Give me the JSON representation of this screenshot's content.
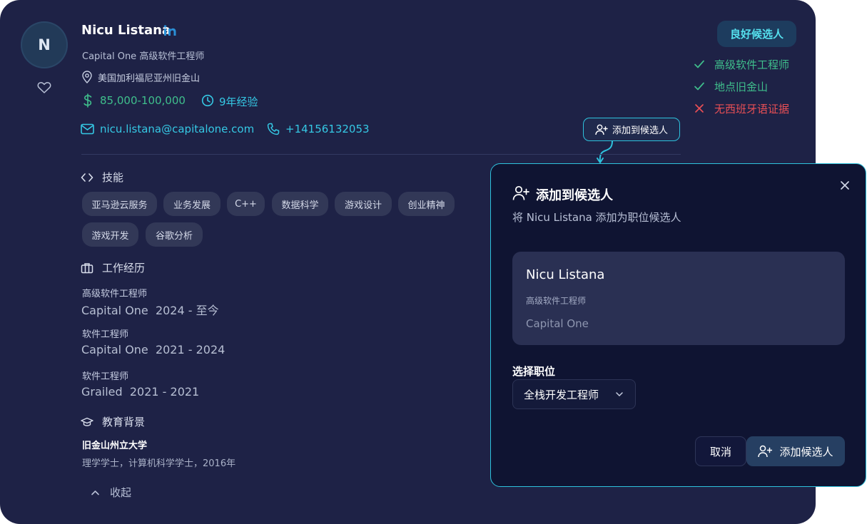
{
  "profile": {
    "avatar_initial": "N",
    "name": "Nicu Listana",
    "title_line": "Capital One 高级软件工程师",
    "location": "美国加利福尼亚州旧金山",
    "salary": "85,000-100,000",
    "experience": "9年经验",
    "email": "nicu.listana@capitalone.com",
    "phone": "+14156132053",
    "badge": "良好候选人",
    "criteria": [
      {
        "label": "高级软件工程师",
        "status": "match"
      },
      {
        "label": "地点旧金山",
        "status": "match"
      },
      {
        "label": "无西班牙语证据",
        "status": "mismatch"
      }
    ],
    "add_to_candidates_button": "添加到候选人"
  },
  "skills": {
    "heading": "技能",
    "items": [
      "亚马逊云服务",
      "业务发展",
      "C++",
      "数据科学",
      "游戏设计",
      "创业精神",
      "游戏开发",
      "谷歌分析"
    ]
  },
  "work": {
    "heading": "工作经历",
    "items": [
      {
        "title": "高级软件工程师",
        "company": "Capital One",
        "period": "2024 - 至今"
      },
      {
        "title": "软件工程师",
        "company": "Capital One",
        "period": "2021 - 2024"
      },
      {
        "title": "软件工程师",
        "company": "Grailed",
        "period": "2021 - 2021"
      }
    ]
  },
  "education": {
    "heading": "教育背景",
    "school": "旧金山州立大学",
    "degree": "理学学士，计算机科学学士，2016年"
  },
  "collapse_label": "收起",
  "modal": {
    "title": "添加到候选人",
    "subtitle": "将 Nicu Listana 添加为职位候选人",
    "card": {
      "name": "Nicu Listana",
      "title": "高级软件工程师",
      "company": "Capital One"
    },
    "select_label": "选择职位",
    "selected_position": "全栈开发工程师",
    "cancel": "取消",
    "confirm": "添加候选人"
  },
  "colors": {
    "card_bg": "#1e2246",
    "accent_cyan": "#35c8e4",
    "green": "#3fbf8c",
    "red": "#e94f55",
    "modal_bg": "#0f1432"
  }
}
